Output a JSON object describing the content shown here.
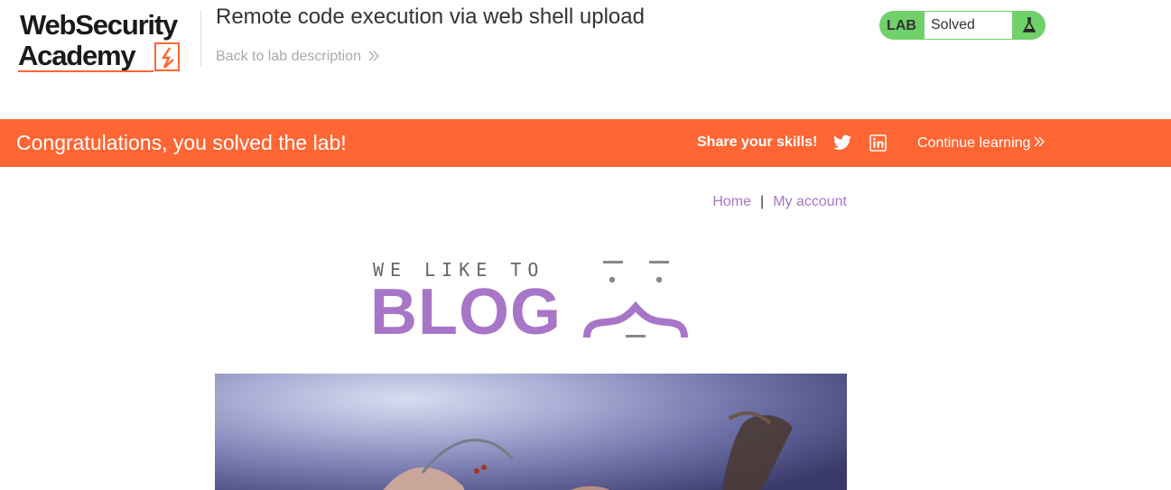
{
  "header": {
    "logo_line1": "WebSecurity",
    "logo_line2": "Academy",
    "lab_title": "Remote code execution via web shell upload",
    "back_link": "Back to lab description",
    "status_label": "LAB",
    "status_value": "Solved"
  },
  "banner": {
    "message": "Congratulations, you solved the lab!",
    "share": "Share your skills!",
    "continue": "Continue learning"
  },
  "nav": {
    "home": "Home",
    "separator": "|",
    "account": "My account"
  },
  "blog_logo": {
    "tagline": "WE LIKE TO",
    "word": "BLOG"
  },
  "colors": {
    "accent": "#ff6633",
    "solved_green": "#70d06a",
    "link_purple": "#a876c8"
  },
  "icons": [
    "lightning-icon",
    "double-chevron-right-icon",
    "flask-icon",
    "twitter-icon",
    "linkedin-icon"
  ]
}
